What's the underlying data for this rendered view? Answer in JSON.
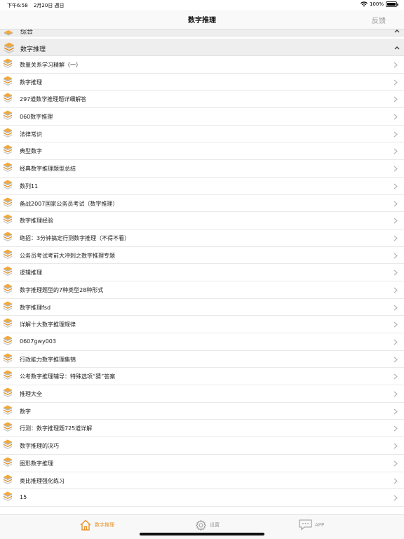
{
  "status_bar": {
    "time": "下午6:58",
    "date": "2月20日 週日",
    "battery": "100%",
    "battery_level": 1.0
  },
  "nav": {
    "title": "数字推理",
    "feedback": "反馈"
  },
  "sections": [
    {
      "label": "综合"
    },
    {
      "label": "数字推理"
    }
  ],
  "items": [
    "数量关系学习精解（一）",
    "数字推理",
    "297道数学推理题详细解答",
    "060数字推理",
    "法律常识",
    "典型数字",
    "经典数字推理题型总结",
    "数列11",
    "备战2007国家公务员考试（数字推理）",
    "数字推理经验",
    "绝招：3分钟搞定行测数字推理（不得不看）",
    "公务员考试考前大冲刺之数字推理专题",
    "逻辑推理",
    "数字推理题型的7种类型28种形式",
    "数字推理fsd",
    "详解十大数字推理规律",
    "0607gwy003",
    "行政能力数字推理集锦",
    "公考数字推理辅导：特殊选项“猜”答案",
    "推理大全",
    "数字",
    "行测：数字推理题725道详解",
    "数字推理的决巧",
    "图形数字推理",
    "类比推理强化练习",
    "15"
  ],
  "tabs": [
    {
      "label": "数字推理",
      "icon": "home-icon",
      "active": true
    },
    {
      "label": "设置",
      "icon": "gear-icon",
      "active": false
    },
    {
      "label": "APP",
      "icon": "chat-icon",
      "active": false
    }
  ],
  "colors": {
    "accent": "#e8922a",
    "book_top": "#f2a93b",
    "book_pages": "#b0b0b0"
  }
}
